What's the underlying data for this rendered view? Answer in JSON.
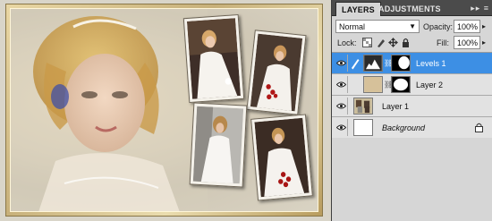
{
  "panel": {
    "tabs": [
      {
        "label": "LAYERS",
        "active": true
      },
      {
        "label": "ADJUSTMENTS",
        "active": false
      }
    ],
    "menu_glyph": "▸▸ ≡",
    "blend_mode": "Normal",
    "opacity_label": "Opacity:",
    "opacity_value": "100%",
    "lock_label": "Lock:",
    "fill_label": "Fill:",
    "fill_value": "100%",
    "layers": [
      {
        "name": "Levels 1",
        "selected": true,
        "italic": false,
        "has_mask": true,
        "adjustment": true
      },
      {
        "name": "Layer 2",
        "selected": false,
        "italic": false,
        "has_mask": true,
        "adjustment": false
      },
      {
        "name": "Layer 1",
        "selected": false,
        "italic": false,
        "has_mask": false,
        "adjustment": false
      },
      {
        "name": "Background",
        "selected": false,
        "italic": true,
        "has_mask": false,
        "locked": true
      }
    ]
  },
  "colors": {
    "selection": "#3d8fe4",
    "panel_bg": "#d6d6d6",
    "tab_bar": "#4b4b4b",
    "frame_gold": "#c7b07a"
  },
  "icons": [
    "eye-icon",
    "brush-icon",
    "chain-icon",
    "lock-icon",
    "lock-transparent-icon",
    "lock-paint-icon",
    "lock-move-icon",
    "lock-all-icon",
    "panel-menu-icon",
    "dropdown-arrow-icon"
  ]
}
